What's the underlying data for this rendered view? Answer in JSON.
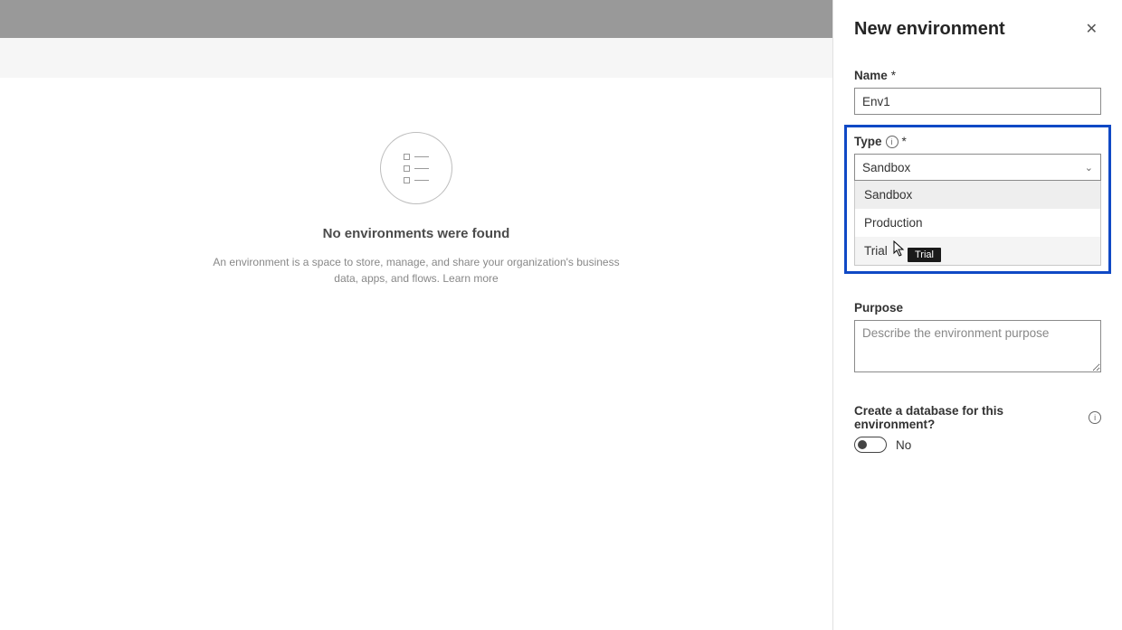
{
  "panel": {
    "title": "New environment",
    "name_label": "Name",
    "name_value": "Env1",
    "type_label": "Type",
    "type_selected": "Sandbox",
    "type_options": {
      "opt0": "Sandbox",
      "opt1": "Production",
      "opt2": "Trial"
    },
    "tooltip_text": "Trial",
    "purpose_label": "Purpose",
    "purpose_placeholder": "Describe the environment purpose",
    "db_label": "Create a database for this environment?",
    "db_value_label": "No"
  },
  "empty": {
    "title": "No environments were found",
    "desc_line": "An environment is a space to store, manage, and share your organization's business data, apps, and flows.",
    "learn_more": "Learn more"
  },
  "required_marker": "*"
}
